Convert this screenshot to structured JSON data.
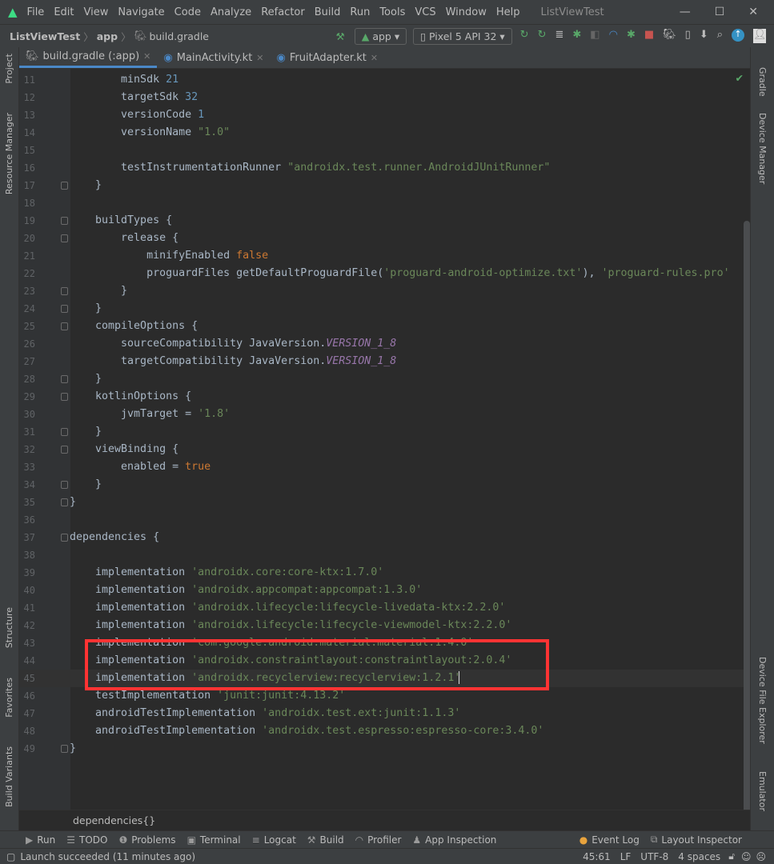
{
  "title_bar": {
    "menus": [
      "File",
      "Edit",
      "View",
      "Navigate",
      "Code",
      "Analyze",
      "Refactor",
      "Build",
      "Run",
      "Tools",
      "VCS",
      "Window",
      "Help"
    ],
    "project_title": "ListViewTest"
  },
  "nav_bar": {
    "breadcrumb": [
      "ListViewTest",
      "app",
      "build.gradle"
    ],
    "run_config": "app",
    "device": "Pixel 5 API 32"
  },
  "tabs": [
    {
      "label": "build.gradle (:app)"
    },
    {
      "label": "MainActivity.kt"
    },
    {
      "label": "FruitAdapter.kt"
    }
  ],
  "left_panels": [
    "Project",
    "Resource Manager",
    "Structure",
    "Favorites",
    "Build Variants"
  ],
  "right_panels": [
    "Gradle",
    "Device Manager",
    "Device File Explorer",
    "Emulator"
  ],
  "code": [
    {
      "n": "11",
      "seg": [
        [
          "        minSdk ",
          ""
        ],
        [
          "21",
          "n"
        ]
      ]
    },
    {
      "n": "12",
      "seg": [
        [
          "        targetSdk ",
          ""
        ],
        [
          "32",
          "n"
        ]
      ]
    },
    {
      "n": "13",
      "seg": [
        [
          "        versionCode ",
          ""
        ],
        [
          "1",
          "n"
        ]
      ]
    },
    {
      "n": "14",
      "seg": [
        [
          "        versionName ",
          ""
        ],
        [
          "\"1.0\"",
          "s"
        ]
      ]
    },
    {
      "n": "15",
      "seg": []
    },
    {
      "n": "16",
      "seg": [
        [
          "        testInstrumentationRunner ",
          ""
        ],
        [
          "\"androidx.test.runner.AndroidJUnitRunner\"",
          "s"
        ]
      ]
    },
    {
      "n": "17",
      "seg": [
        [
          "    }",
          ""
        ]
      ],
      "fold": true
    },
    {
      "n": "18",
      "seg": []
    },
    {
      "n": "19",
      "seg": [
        [
          "    buildTypes {",
          ""
        ]
      ],
      "fold": true
    },
    {
      "n": "20",
      "seg": [
        [
          "        release {",
          ""
        ]
      ],
      "fold": true
    },
    {
      "n": "21",
      "seg": [
        [
          "            minifyEnabled ",
          ""
        ],
        [
          "false",
          "k"
        ]
      ]
    },
    {
      "n": "22",
      "seg": [
        [
          "            proguardFiles getDefaultProguardFile(",
          ""
        ],
        [
          "'proguard-android-optimize.txt'",
          "s"
        ],
        [
          "), ",
          ""
        ],
        [
          "'proguard-rules.pro'",
          "s"
        ]
      ]
    },
    {
      "n": "23",
      "seg": [
        [
          "        }",
          ""
        ]
      ],
      "fold": true
    },
    {
      "n": "24",
      "seg": [
        [
          "    }",
          ""
        ]
      ],
      "fold": true
    },
    {
      "n": "25",
      "seg": [
        [
          "    compileOptions {",
          ""
        ]
      ],
      "fold": true
    },
    {
      "n": "26",
      "seg": [
        [
          "        sourceCompatibility JavaVersion.",
          ""
        ],
        [
          "VERSION_1_8",
          "c"
        ]
      ]
    },
    {
      "n": "27",
      "seg": [
        [
          "        targetCompatibility JavaVersion.",
          ""
        ],
        [
          "VERSION_1_8",
          "c"
        ]
      ]
    },
    {
      "n": "28",
      "seg": [
        [
          "    }",
          ""
        ]
      ],
      "fold": true
    },
    {
      "n": "29",
      "seg": [
        [
          "    kotlinOptions {",
          ""
        ]
      ],
      "fold": true
    },
    {
      "n": "30",
      "seg": [
        [
          "        jvmTarget = ",
          ""
        ],
        [
          "'1.8'",
          "s"
        ]
      ]
    },
    {
      "n": "31",
      "seg": [
        [
          "    }",
          ""
        ]
      ],
      "fold": true
    },
    {
      "n": "32",
      "seg": [
        [
          "    viewBinding {",
          ""
        ]
      ],
      "fold": true
    },
    {
      "n": "33",
      "seg": [
        [
          "        enabled = ",
          ""
        ],
        [
          "true",
          "k"
        ]
      ]
    },
    {
      "n": "34",
      "seg": [
        [
          "    }",
          ""
        ]
      ],
      "fold": true
    },
    {
      "n": "35",
      "seg": [
        [
          "}",
          ""
        ]
      ],
      "fold": true
    },
    {
      "n": "36",
      "seg": []
    },
    {
      "n": "37",
      "seg": [
        [
          "dependencies {",
          ""
        ]
      ],
      "fold": true
    },
    {
      "n": "38",
      "seg": []
    },
    {
      "n": "39",
      "seg": [
        [
          "    implementation ",
          ""
        ],
        [
          "'androidx.core:core-ktx:1.7.0'",
          "s"
        ]
      ]
    },
    {
      "n": "40",
      "seg": [
        [
          "    implementation ",
          ""
        ],
        [
          "'androidx.appcompat:appcompat:1.3.0'",
          "s"
        ]
      ]
    },
    {
      "n": "41",
      "seg": [
        [
          "    implementation ",
          ""
        ],
        [
          "'androidx.lifecycle:lifecycle-livedata-ktx:2.2.0'",
          "s"
        ]
      ]
    },
    {
      "n": "42",
      "seg": [
        [
          "    implementation ",
          ""
        ],
        [
          "'androidx.lifecycle:lifecycle-viewmodel-ktx:2.2.0'",
          "s"
        ]
      ]
    },
    {
      "n": "43",
      "seg": [
        [
          "    implementation ",
          ""
        ],
        [
          "'com.google.android.material:material:1.4.0'",
          "s"
        ]
      ]
    },
    {
      "n": "44",
      "seg": [
        [
          "    implementation ",
          ""
        ],
        [
          "'androidx.constraintlayout:constraintlayout:2.0.4'",
          "s"
        ]
      ]
    },
    {
      "n": "45",
      "seg": [
        [
          "    implementation ",
          ""
        ],
        [
          "'androidx.recyclerview:recyclerview:1.2.1'",
          "s"
        ]
      ],
      "current": true
    },
    {
      "n": "46",
      "seg": [
        [
          "    testImplementation ",
          ""
        ],
        [
          "'junit:junit:4.13.2'",
          "s"
        ]
      ]
    },
    {
      "n": "47",
      "seg": [
        [
          "    androidTestImplementation ",
          ""
        ],
        [
          "'androidx.test.ext:junit:1.1.3'",
          "s"
        ]
      ]
    },
    {
      "n": "48",
      "seg": [
        [
          "    androidTestImplementation ",
          ""
        ],
        [
          "'androidx.test.espresso:espresso-core:3.4.0'",
          "s"
        ]
      ]
    },
    {
      "n": "49",
      "seg": [
        [
          "}",
          ""
        ]
      ],
      "fold": true
    }
  ],
  "editor_breadcrumb": "dependencies{}",
  "tool_windows": [
    {
      "icon": "▶",
      "label": "Run"
    },
    {
      "icon": "☰",
      "label": "TODO"
    },
    {
      "icon": "❶",
      "label": "Problems"
    },
    {
      "icon": "▣",
      "label": "Terminal"
    },
    {
      "icon": "≡",
      "label": "Logcat"
    },
    {
      "icon": "⚒",
      "label": "Build"
    },
    {
      "icon": "◠",
      "label": "Profiler"
    },
    {
      "icon": "♟",
      "label": "App Inspection"
    }
  ],
  "tool_windows_right": [
    {
      "icon": "●",
      "label": "Event Log"
    },
    {
      "icon": "⧉",
      "label": "Layout Inspector"
    }
  ],
  "status": {
    "message": "Launch succeeded (11 minutes ago)",
    "position": "45:61",
    "line_sep": "LF",
    "encoding": "UTF-8",
    "indent": "4 spaces"
  }
}
